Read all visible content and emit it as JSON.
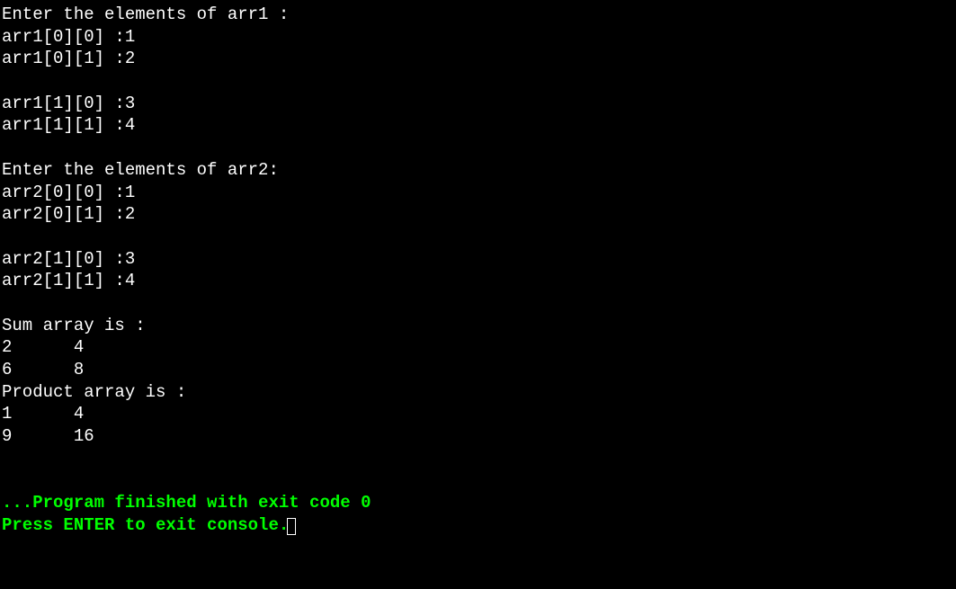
{
  "console": {
    "lines": [
      "Enter the elements of arr1 :",
      "arr1[0][0] :1",
      "arr1[0][1] :2",
      "",
      "arr1[1][0] :3",
      "arr1[1][1] :4",
      "",
      "Enter the elements of arr2:",
      "arr2[0][0] :1",
      "arr2[0][1] :2",
      "",
      "arr2[1][0] :3",
      "arr2[1][1] :4",
      "",
      "Sum array is :",
      "2      4",
      "6      8",
      "Product array is :",
      "1      4",
      "9      16",
      "",
      ""
    ],
    "exit_message": "...Program finished with exit code 0",
    "prompt_message": "Press ENTER to exit console."
  }
}
